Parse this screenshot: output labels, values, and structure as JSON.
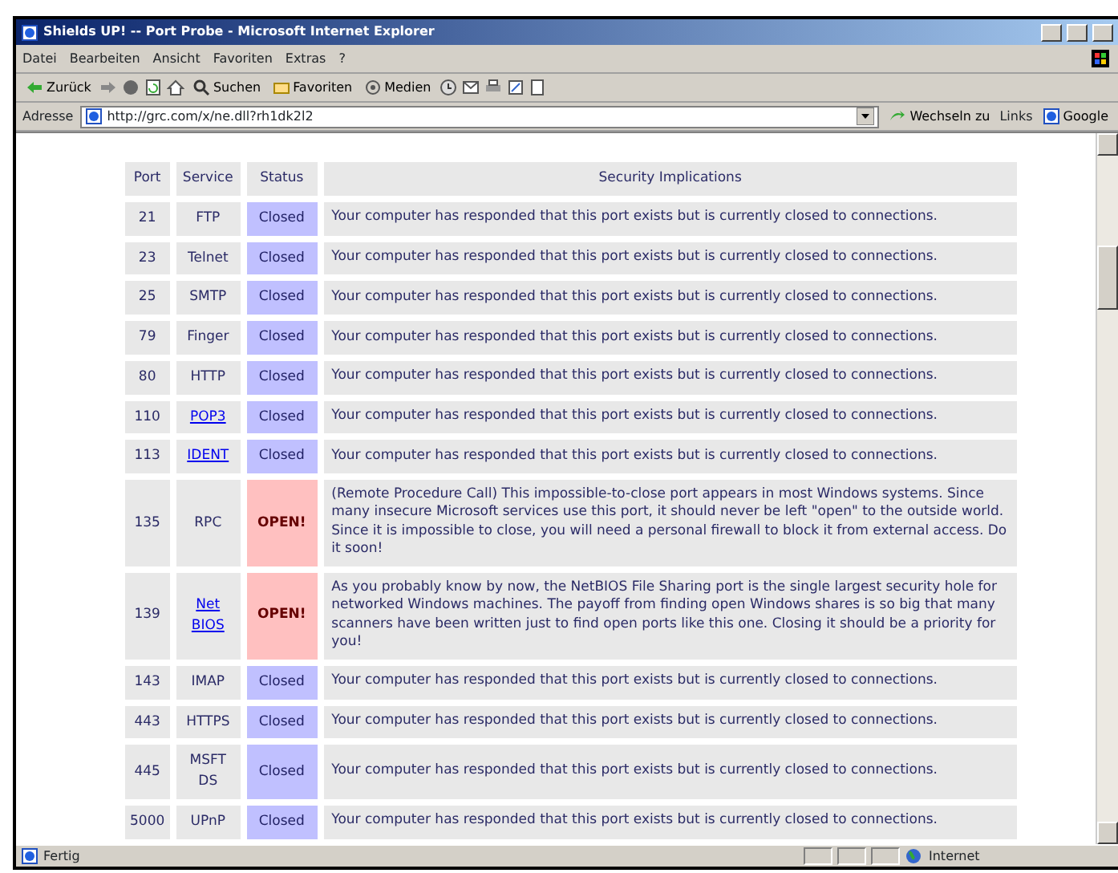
{
  "window": {
    "title": "Shields UP! -- Port Probe - Microsoft Internet Explorer"
  },
  "menu": [
    "Datei",
    "Bearbeiten",
    "Ansicht",
    "Favoriten",
    "Extras",
    "?"
  ],
  "toolbar": [
    {
      "kind": "back",
      "label": "Zurück"
    },
    {
      "kind": "forward"
    },
    {
      "kind": "stop"
    },
    {
      "kind": "refresh"
    },
    {
      "kind": "home"
    },
    {
      "kind": "search",
      "label": "Suchen"
    },
    {
      "kind": "favorites",
      "label": "Favoriten"
    },
    {
      "kind": "media",
      "label": "Medien"
    },
    {
      "kind": "history"
    },
    {
      "kind": "mail"
    },
    {
      "kind": "print"
    },
    {
      "kind": "edit"
    },
    {
      "kind": "discuss"
    }
  ],
  "address_bar": {
    "label": "Adresse",
    "url": "http://grc.com/x/ne.dll?rh1dk2l2",
    "go": "Wechseln zu",
    "links": "Links",
    "google": "Google"
  },
  "table": {
    "columns": [
      "Port",
      "Service",
      "Status",
      "Security Implications"
    ],
    "rows": [
      {
        "port": "21",
        "service": "FTP",
        "link": false,
        "status": "Closed",
        "open": false,
        "text": "Your computer has responded that this port exists but is currently closed to connections."
      },
      {
        "port": "23",
        "service": "Telnet",
        "link": false,
        "status": "Closed",
        "open": false,
        "text": "Your computer has responded that this port exists but is currently closed to connections."
      },
      {
        "port": "25",
        "service": "SMTP",
        "link": false,
        "status": "Closed",
        "open": false,
        "text": "Your computer has responded that this port exists but is currently closed to connections."
      },
      {
        "port": "79",
        "service": "Finger",
        "link": false,
        "status": "Closed",
        "open": false,
        "text": "Your computer has responded that this port exists but is currently closed to connections."
      },
      {
        "port": "80",
        "service": "HTTP",
        "link": false,
        "status": "Closed",
        "open": false,
        "text": "Your computer has responded that this port exists but is currently closed to connections."
      },
      {
        "port": "110",
        "service": "POP3",
        "link": true,
        "status": "Closed",
        "open": false,
        "text": "Your computer has responded that this port exists but is currently closed to connections."
      },
      {
        "port": "113",
        "service": "IDENT",
        "link": true,
        "status": "Closed",
        "open": false,
        "text": "Your computer has responded that this port exists but is currently closed to connections."
      },
      {
        "port": "135",
        "service": "RPC",
        "link": false,
        "status": "OPEN!",
        "open": true,
        "text": "(Remote Procedure Call) This impossible-to-close port appears in most Windows systems. Since many insecure Microsoft services use this port, it should never be left \"open\" to the outside world. Since it is impossible to close, you will need a personal firewall to block it from external access. Do it soon!"
      },
      {
        "port": "139",
        "service": "Net BIOS",
        "link": true,
        "status": "OPEN!",
        "open": true,
        "text": "As you probably know by now, the NetBIOS File Sharing port is the single largest security hole for networked Windows machines. The payoff from finding open Windows shares is so big that many scanners have been written just to find open ports like this one. Closing it should be a priority for you!"
      },
      {
        "port": "143",
        "service": "IMAP",
        "link": false,
        "status": "Closed",
        "open": false,
        "text": "Your computer has responded that this port exists but is currently closed to connections."
      },
      {
        "port": "443",
        "service": "HTTPS",
        "link": false,
        "status": "Closed",
        "open": false,
        "text": "Your computer has responded that this port exists but is currently closed to connections."
      },
      {
        "port": "445",
        "service": "MSFT DS",
        "link": false,
        "status": "Closed",
        "open": false,
        "text": "Your computer has responded that this port exists but is currently closed to connections."
      },
      {
        "port": "5000",
        "service": "UPnP",
        "link": false,
        "status": "Closed",
        "open": false,
        "text": "Your computer has responded that this port exists but is currently closed to connections."
      }
    ]
  },
  "status_bar": {
    "text": "Fertig",
    "zone": "Internet"
  }
}
